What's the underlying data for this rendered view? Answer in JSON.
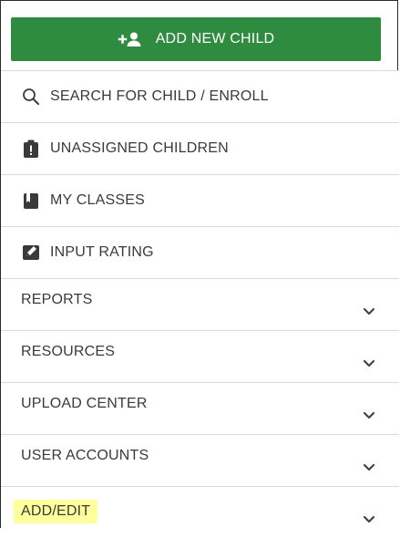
{
  "colors": {
    "primary_green": "#2e8b3f",
    "text": "#3a3a3a",
    "divider": "#d9d9d9",
    "highlight": "#ffff9b"
  },
  "header": {
    "add_new_child": {
      "label": "ADD NEW CHILD",
      "icon": "add-person-icon"
    }
  },
  "menu": {
    "items": [
      {
        "label": "SEARCH FOR CHILD / ENROLL",
        "icon": "search-icon"
      },
      {
        "label": "UNASSIGNED CHILDREN",
        "icon": "clipboard-alert-icon"
      },
      {
        "label": "MY CLASSES",
        "icon": "book-icon"
      },
      {
        "label": "INPUT RATING",
        "icon": "edit-rating-icon"
      },
      {
        "label": "REPORTS",
        "icon": "chevron-down-icon"
      },
      {
        "label": "RESOURCES",
        "icon": "chevron-down-icon"
      },
      {
        "label": "UPLOAD CENTER",
        "icon": "chevron-down-icon"
      },
      {
        "label": "USER ACCOUNTS",
        "icon": "chevron-down-icon"
      },
      {
        "label": "ADD/EDIT",
        "icon": "chevron-down-icon",
        "highlighted": true
      }
    ]
  }
}
